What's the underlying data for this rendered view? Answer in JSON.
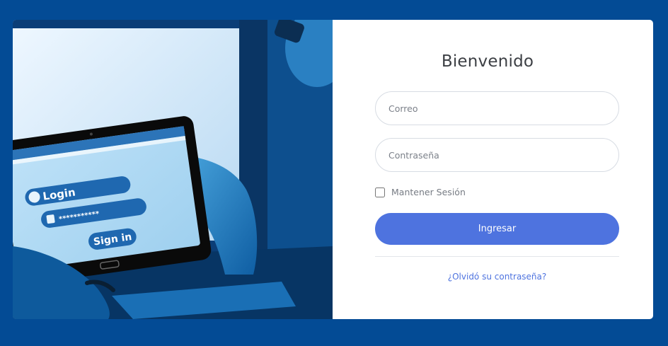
{
  "login": {
    "title": "Bienvenido",
    "email_placeholder": "Correo",
    "password_placeholder": "Contraseña",
    "remember_label": "Mantener Sesión",
    "submit_label": "Ingresar",
    "forgot_link": "¿Olvidó su contraseña?"
  },
  "hero_image": {
    "login_label": "Login",
    "password_mask": "***********",
    "signin_label": "Sign in"
  },
  "colors": {
    "page_background": "#034b95",
    "submit_button": "#4e73df",
    "link": "#4e73df",
    "card_background": "#ffffff"
  }
}
